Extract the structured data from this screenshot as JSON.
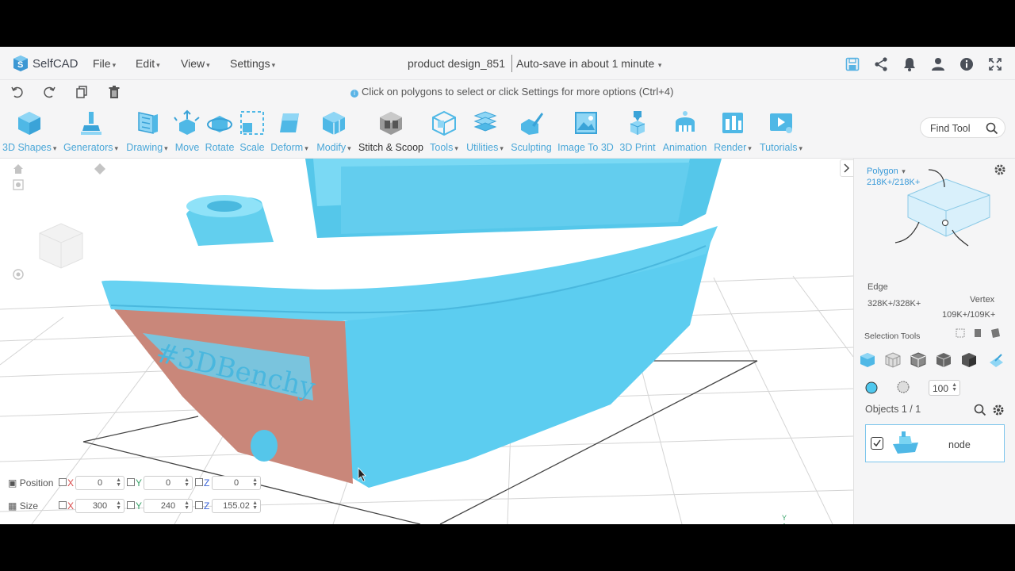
{
  "app": {
    "name": "SelfCAD"
  },
  "menu": [
    {
      "label": "File"
    },
    {
      "label": "Edit"
    },
    {
      "label": "View"
    },
    {
      "label": "Settings"
    }
  ],
  "document": {
    "title": "product design_851",
    "autosave": "Auto-save in about 1 minute"
  },
  "hint": "Click on polygons to select or click Settings for more options (Ctrl+4)",
  "toolbar": {
    "tools": [
      {
        "label": "3D Shapes",
        "dropdown": true
      },
      {
        "label": "Generators",
        "dropdown": true
      },
      {
        "label": "Drawing",
        "dropdown": true
      },
      {
        "label": "Move",
        "dropdown": false
      },
      {
        "label": "Rotate",
        "dropdown": false
      },
      {
        "label": "Scale",
        "dropdown": false
      },
      {
        "label": "Deform",
        "dropdown": true
      },
      {
        "label": "Modify",
        "dropdown": true
      },
      {
        "label": "Stitch & Scoop",
        "dropdown": false
      },
      {
        "label": "Tools",
        "dropdown": true
      },
      {
        "label": "Utilities",
        "dropdown": true
      },
      {
        "label": "Sculpting",
        "dropdown": false
      },
      {
        "label": "Image To 3D",
        "dropdown": false
      },
      {
        "label": "3D Print",
        "dropdown": false
      },
      {
        "label": "Animation",
        "dropdown": false
      },
      {
        "label": "Render",
        "dropdown": true
      },
      {
        "label": "Tutorials",
        "dropdown": true
      }
    ],
    "find_tool": "Find Tool"
  },
  "model": {
    "label": "#3DBenchy"
  },
  "transform": {
    "position": {
      "label": "Position",
      "x": "0",
      "y": "0",
      "z": "0"
    },
    "size": {
      "label": "Size",
      "x": "300",
      "y": "240",
      "z": "155.02"
    },
    "axes": {
      "x": "X",
      "y": "Y",
      "z": "Z"
    }
  },
  "selection": {
    "polygon": {
      "label": "Polygon",
      "count": "218K+/218K+"
    },
    "edge": {
      "label": "Edge",
      "count": "328K+/328K+"
    },
    "vertex": {
      "label": "Vertex",
      "count": "109K+/109K+"
    },
    "tools_label": "Selection Tools",
    "size_value": "100"
  },
  "objects": {
    "label": "Objects 1 / 1",
    "items": [
      {
        "name": "node",
        "checked": true
      }
    ]
  },
  "colors": {
    "accent": "#4aa7d8",
    "model": "#62d4f2",
    "selected_face": "#c9877a"
  }
}
